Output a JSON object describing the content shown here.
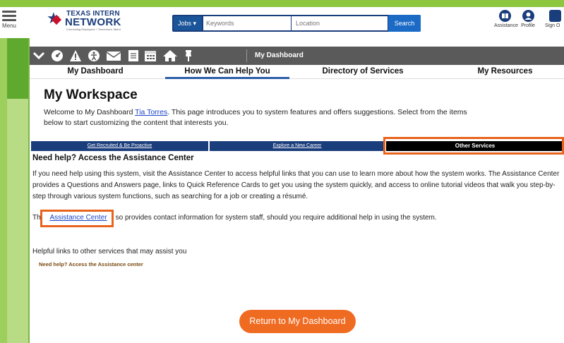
{
  "colors": {
    "frame_green": "#8dc63f",
    "navy": "#1a3d7c",
    "highlight_orange": "#e8631c",
    "return_button": "#f06b22",
    "toolbar_gray": "#5a5a5a",
    "link_blue": "#1a44c8"
  },
  "header": {
    "menu_label": "Menu",
    "logo_line1": "TEXAS INTERN",
    "logo_line2": "NETWORK",
    "logo_tagline": "Connecting Employers + Tomorrow's Talent",
    "search": {
      "jobs_select": "Jobs",
      "keyword_placeholder": "Keywords",
      "location_placeholder": "Location",
      "search_label": "Search"
    },
    "icons": [
      {
        "icon": "assistance-icon",
        "label": "Assistance"
      },
      {
        "icon": "profile-icon",
        "label": "Profile"
      },
      {
        "icon": "sign-out-icon",
        "label": "Sign O"
      }
    ]
  },
  "toolbar": {
    "icons": [
      "chevron-down-icon",
      "dashboard-gauge-icon",
      "alert-icon",
      "accessibility-icon",
      "mail-icon",
      "document-icon",
      "calendar-icon",
      "home-icon",
      "pin-icon"
    ],
    "title": "My Dashboard"
  },
  "nav": {
    "tabs": [
      {
        "label": "My Dashboard"
      },
      {
        "label": "How We Can Help You"
      },
      {
        "label": "Directory of Services"
      },
      {
        "label": "My Resources"
      }
    ]
  },
  "main": {
    "title": "My Workspace",
    "intro_before": "Welcome to My Dashboard ",
    "user_name": "Tia Torres",
    "intro_after": ". This page introduces you to system features and offers suggestions. Select from the items below to start customizing the content that interests you.",
    "service_tabs": [
      {
        "label": "Get Recruited & Be Proactive"
      },
      {
        "label": "Explore a New Career"
      },
      {
        "label": "Other Services"
      }
    ],
    "section_heading": "Need help? Access the Assistance Center",
    "paragraph": "If you need help using this system, visit the Assistance Center to access helpful links that you can use to learn more about how the system works. The Assistance Center provides a Questions and Answers page, links to Quick Reference Cards to get you using the system quickly, and access to online tutorial videos that walk you step-by-step through various system functions, such as searching for a job or creating a résumé.",
    "para2_prefix": "Th",
    "assistance_link": "Assistance Center",
    "para2_suffix": "so provides contact information for system staff, should you require additional help in using the system.",
    "helpful_heading": "Helpful links to other services that may assist you",
    "helpful_link": "Need help? Access the Assistance center",
    "return_button": "Return to My Dashboard"
  }
}
